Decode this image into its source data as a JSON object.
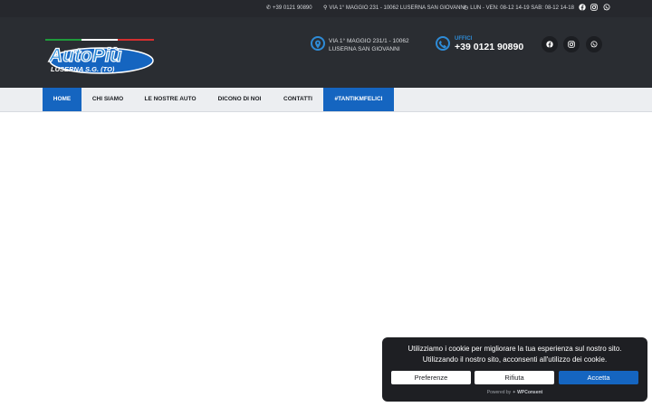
{
  "topbar": {
    "phone": "+39 0121 90890",
    "address": "VIA 1° MAGGIO 231 - 10062 LUSERNA SAN GIOVANNI",
    "hours": "LUN - VEN: 08-12 14-19 SAB: 08-12 14-18",
    "icons": [
      "phone-icon",
      "map-pin-icon",
      "clock-icon",
      "facebook-icon",
      "instagram-icon",
      "whatsapp-icon"
    ]
  },
  "logo": {
    "brand": "AutoPiù",
    "sub": "LUSERNA S.G. (TO)"
  },
  "header": {
    "address_line1": "VIA 1° MAGGIO 231/1 - 10062",
    "address_line2": "LUSERNA SAN GIOVANNI",
    "office_label": "UFFICI",
    "office_phone": "+39 0121 90890"
  },
  "nav": {
    "items": [
      {
        "label": "HOME"
      },
      {
        "label": "CHI SIAMO"
      },
      {
        "label": "LE NOSTRE AUTO"
      },
      {
        "label": "DICONO DI NOI"
      },
      {
        "label": "CONTATTI"
      },
      {
        "label": "#TANTIKMFELICI"
      }
    ]
  },
  "cookie": {
    "line1": "Utilizziamo i cookie per migliorare la tua esperienza sul nostro sito.",
    "line2": "Utilizzando il nostro sito, acconsenti all'utilizzo dei cookie.",
    "btn_prefs": "Preferenze",
    "btn_reject": "Rifiuta",
    "btn_accept": "Accetta",
    "powered_by": "Powered by",
    "powered_brand": "WPConsent"
  },
  "colors": {
    "topbar_bg": "#26282d",
    "header_bg": "#2a2d32",
    "accent_blue": "#1565c0",
    "icon_blue": "#2e8bd6",
    "cookie_bg": "#1e1f23"
  }
}
